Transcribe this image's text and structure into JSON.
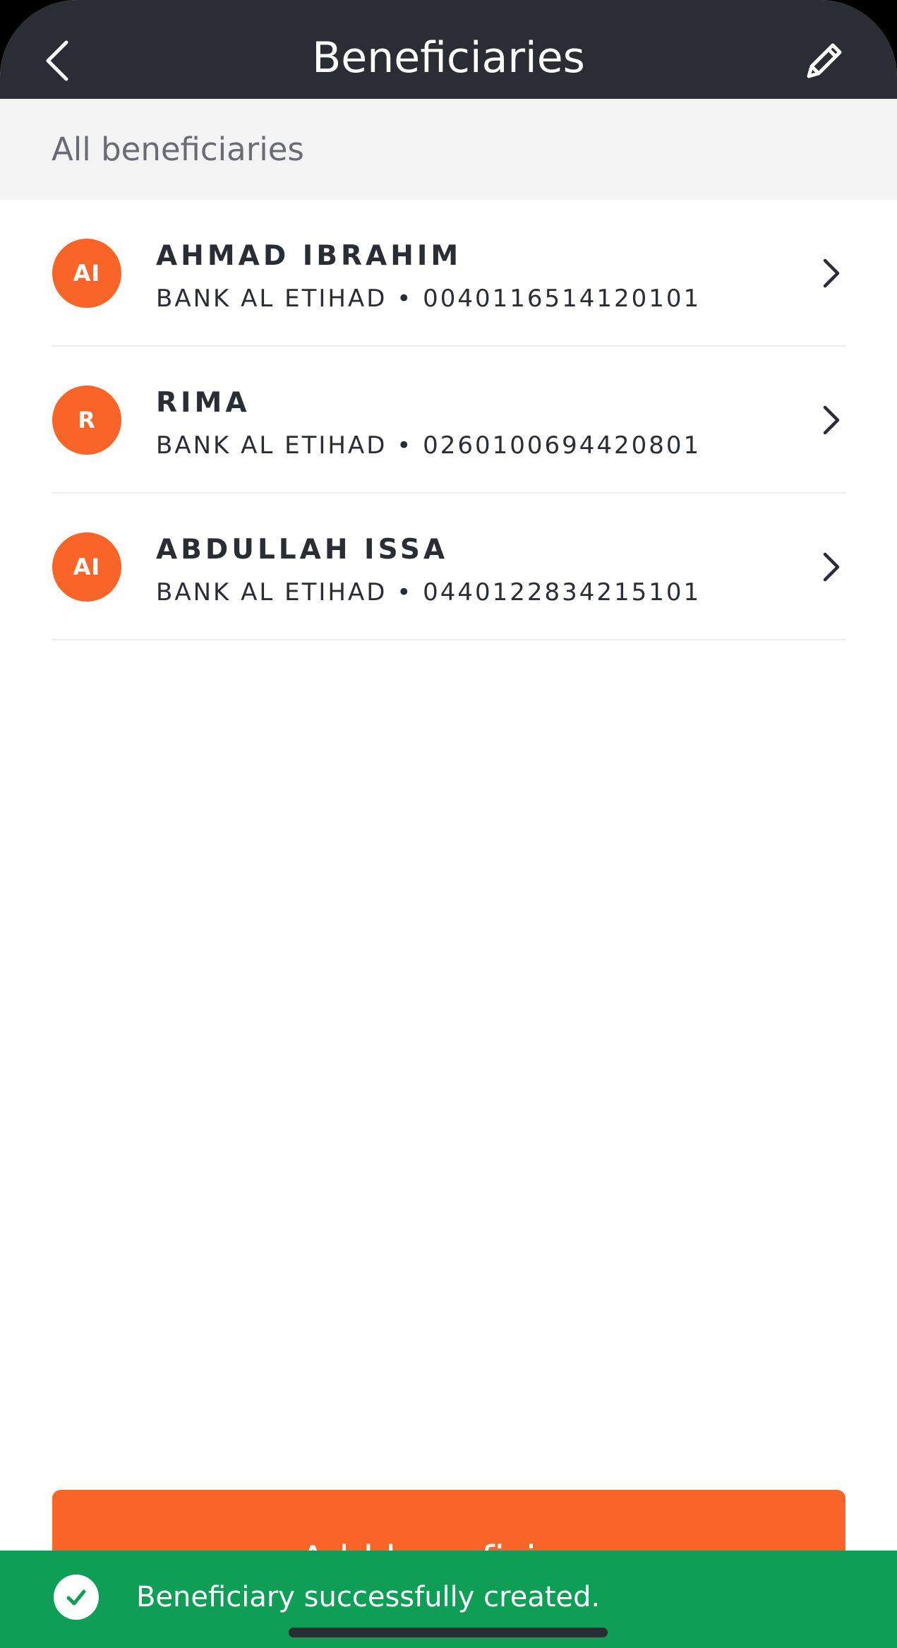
{
  "header": {
    "title": "Beneficiaries",
    "back_icon": "chevron-left-icon",
    "edit_icon": "pencil-icon"
  },
  "section": {
    "label": "All beneficiaries"
  },
  "beneficiaries": [
    {
      "initials": "AI",
      "name": "AHMAD IBRAHIM",
      "bank": "BANK AL ETIHAD • 0040116514120101"
    },
    {
      "initials": "R",
      "name": "RIMA",
      "bank": "BANK AL ETIHAD • 0260100694420801"
    },
    {
      "initials": "AI",
      "name": "ABDULLAH ISSA",
      "bank": "BANK AL ETIHAD • 0440122834215101"
    }
  ],
  "add_button": {
    "label": "Add beneficiary"
  },
  "toast": {
    "message": "Beneficiary successfully created.",
    "icon": "check-icon"
  },
  "colors": {
    "header_bg": "#2b2d35",
    "accent": "#f96428",
    "success": "#0f9e56",
    "section_bg": "#f3f3f3"
  }
}
